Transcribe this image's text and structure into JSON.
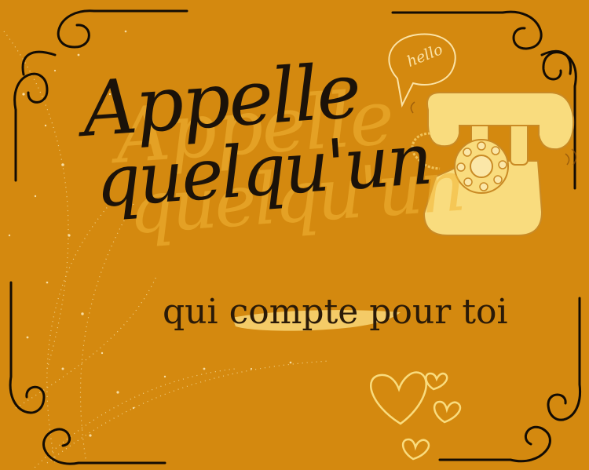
{
  "card": {
    "title_line1": "Appelle",
    "title_line2": "quelqu'un",
    "subtitle_part1": "qui ",
    "subtitle_highlight": "compte",
    "subtitle_part2": " pour toi",
    "bubble_text": "hello"
  },
  "colors": {
    "background": "#d4890f",
    "ink": "#1b1209",
    "phone": "#f9dc7e",
    "sparkle": "#f7dfa0"
  },
  "icons": [
    "ornate-corner-icon",
    "speech-bubble-icon",
    "telephone-icon",
    "hearts-icon",
    "sparkle-trail-icon"
  ]
}
